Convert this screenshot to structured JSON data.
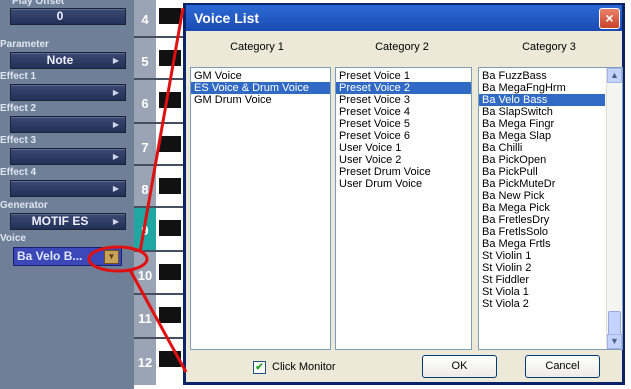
{
  "left_panel": {
    "play_offset": {
      "label": "Play Offset",
      "value": "0"
    },
    "parameter": {
      "label": "Parameter",
      "value": "Note"
    },
    "effect1": {
      "label": "Effect 1",
      "value": ""
    },
    "effect2": {
      "label": "Effect 2",
      "value": ""
    },
    "effect3": {
      "label": "Effect 3",
      "value": ""
    },
    "effect4": {
      "label": "Effect 4",
      "value": ""
    },
    "generator": {
      "label": "Generator",
      "value": "MOTIF ES"
    },
    "voice": {
      "label": "Voice",
      "value": "Ba Velo B..."
    }
  },
  "tracks": [
    "4",
    "5",
    "6",
    "7",
    "8",
    "9",
    "10",
    "11",
    "12"
  ],
  "selected_track": "9",
  "dialog": {
    "title": "Voice List",
    "category_headers": [
      "Category 1",
      "Category 2",
      "Category 3"
    ],
    "category1": [
      "GM Voice",
      "ES Voice & Drum Voice",
      "GM Drum Voice"
    ],
    "category1_selected": "ES Voice & Drum Voice",
    "category2": [
      "Preset Voice 1",
      "Preset Voice 2",
      "Preset Voice 3",
      "Preset Voice 4",
      "Preset Voice 5",
      "Preset Voice 6",
      "User Voice 1",
      "User Voice 2",
      "Preset Drum Voice",
      "User Drum Voice"
    ],
    "category2_selected": "Preset Voice 2",
    "category3": [
      "Ba FuzzBass",
      "Ba MegaFngHrm",
      "Ba Velo Bass",
      "Ba SlapSwitch",
      "Ba Mega Fingr",
      "Ba Mega Slap",
      "Ba Chilli",
      "Ba PickOpen",
      "Ba PickPull",
      "Ba PickMuteDr",
      "Ba New Pick",
      "Ba Mega Pick",
      "Ba FretlesDry",
      "Ba FretlsSolo",
      "Ba Mega Frtls",
      "St Violin 1",
      "St Violin 2",
      "St Fiddler",
      "St Viola 1",
      "St Viola 2"
    ],
    "category3_selected": "Ba Velo Bass",
    "click_monitor": {
      "label": "Click Monitor",
      "checked": true
    },
    "ok_label": "OK",
    "cancel_label": "Cancel",
    "close_label": "×"
  },
  "icons": {
    "scroll_up": "▲",
    "scroll_down": "▼",
    "dropdown": "▼",
    "arrow_right": "▶",
    "check": "✔"
  },
  "colors": {
    "selection": "#316ac5",
    "titlebar": "#2d6ad6",
    "annotation_red": "#e01010",
    "selected_track": "#1fa7a4"
  }
}
